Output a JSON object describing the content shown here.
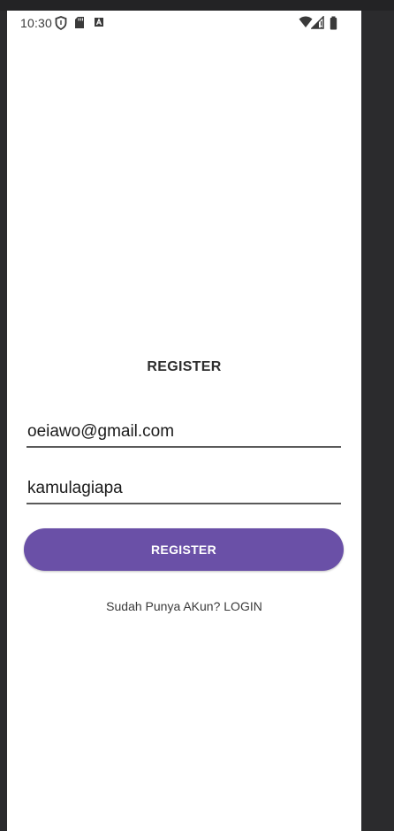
{
  "status_bar": {
    "time": "10:30",
    "icons": [
      "shield-icon",
      "sd-card-icon",
      "a-box-icon",
      "wifi-icon",
      "signal-icon",
      "battery-icon"
    ]
  },
  "register_form": {
    "title": "REGISTER",
    "email_value": "oeiawo@gmail.com",
    "password_value": "kamulagiapa",
    "submit_label": "REGISTER",
    "login_prompt": "Sudah Punya AKun? LOGIN"
  },
  "colors": {
    "accent": "#6a50a7",
    "background": "#ffffff",
    "outer_background": "#2b2b2d",
    "spellcheck": "#d32f2f"
  }
}
